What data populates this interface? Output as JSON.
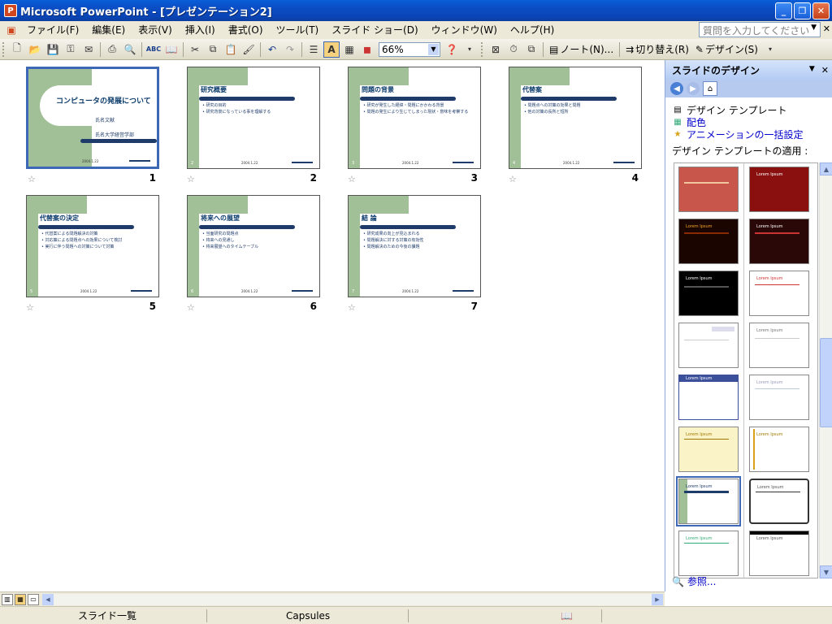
{
  "window": {
    "title": "Microsoft PowerPoint - [プレゼンテーション2]",
    "app_icon": "P"
  },
  "menu": {
    "items": [
      "ファイル(F)",
      "編集(E)",
      "表示(V)",
      "挿入(I)",
      "書式(O)",
      "ツール(T)",
      "スライド ショー(D)",
      "ウィンドウ(W)",
      "ヘルプ(H)"
    ],
    "help_placeholder": "質問を入力してください"
  },
  "toolbar": {
    "zoom": "66%",
    "notes_label": "ノート(N)...",
    "transition_label": "切り替え(R)",
    "design_label": "デザイン(S)"
  },
  "slides": [
    {
      "num": "1",
      "type": "title",
      "title": "コンピュータの発展について",
      "sub1": "氏名文献",
      "sub2": "氏名大学経営学部",
      "footer": "2004.1.22"
    },
    {
      "num": "2",
      "title": "研究概要",
      "bullets": [
        "研究の目的",
        "研究背景になっている事を理解する"
      ],
      "footer": "2004.1.22"
    },
    {
      "num": "3",
      "title": "問題の背景",
      "bullets": [
        "研究が発生した経緯・問題にかかわる背景",
        "問題の発生により生じてしまった現状・意味を考察する"
      ],
      "footer": "2004.1.22"
    },
    {
      "num": "4",
      "title": "代替案",
      "bullets": [
        "問題点への対策の効果と問題",
        "他の対策の長所と短所"
      ],
      "footer": "2004.1.22"
    },
    {
      "num": "5",
      "title": "代替案の決定",
      "bullets": [
        "代替案による問題解決の対策",
        "対応策による問題点への効果について検討",
        "実行に伴う問題への対策について対策"
      ],
      "footer": "2004.1.22"
    },
    {
      "num": "6",
      "title": "将来への展望",
      "bullets": [
        "当面研究の問題点",
        "将来への見通し",
        "将来展望へのタイムテーブル"
      ],
      "footer": "2004.1.22"
    },
    {
      "num": "7",
      "title": "結 論",
      "bullets": [
        "研究成果の向上が見込まれる",
        "問題解決に対する対策の有効性",
        "問題解決のための今後の課題"
      ],
      "footer": "2004.1.22"
    }
  ],
  "pane": {
    "title": "スライドのデザイン",
    "links": [
      "デザイン テンプレート",
      "配色",
      "アニメーションの一括設定"
    ],
    "apply_label": "デザイン テンプレートの適用 :",
    "template_text": "Lorem Ipsum",
    "browse_label": "参照..."
  },
  "status": {
    "view": "スライド一覧",
    "template": "Capsules"
  },
  "colors": {
    "green": "#a2c097",
    "navy": "#1f3b6a",
    "xp_blue": "#0b4cc3"
  }
}
